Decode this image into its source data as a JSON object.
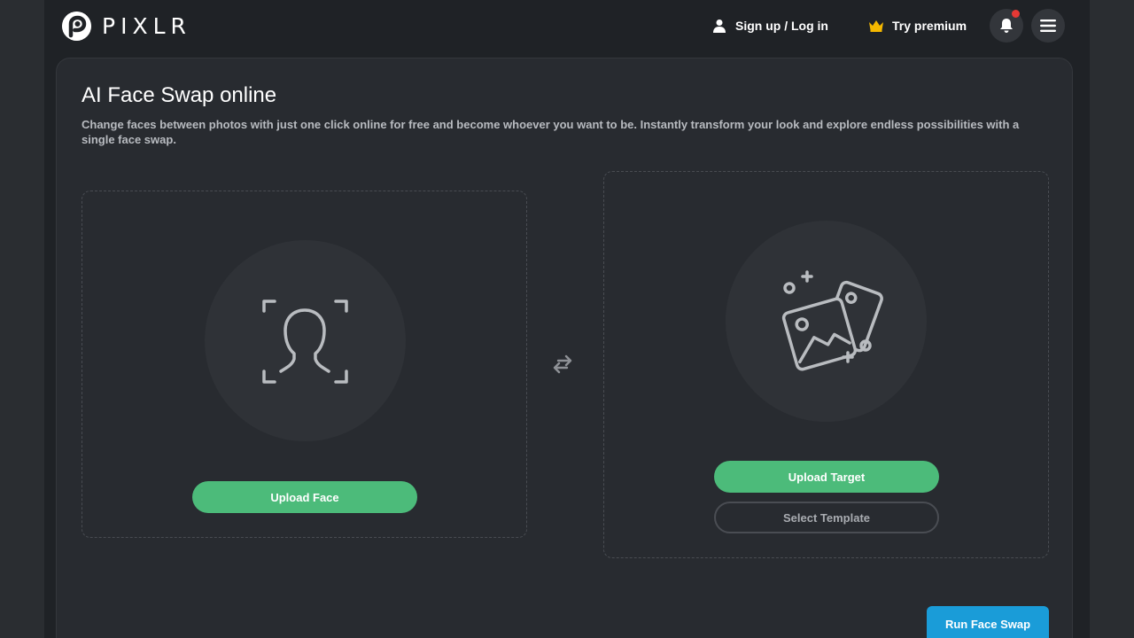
{
  "brand": {
    "name": "PIXLR"
  },
  "nav": {
    "signin_label": "Sign up / Log in",
    "premium_label": "Try premium",
    "icons": [
      "user-icon",
      "crown-icon",
      "bell-icon",
      "menu-icon"
    ]
  },
  "page": {
    "title": "AI Face Swap online",
    "description": "Change faces between photos with just one click online for free and become whoever you want to be. Instantly transform your look and explore endless possibilities with a single face swap."
  },
  "face_panel": {
    "upload_label": "Upload Face"
  },
  "target_panel": {
    "upload_label": "Upload Target",
    "template_label": "Select Template"
  },
  "actions": {
    "run_label": "Run Face Swap"
  },
  "colors": {
    "accent_green": "#4cbb7a",
    "accent_blue": "#1a9cd8",
    "premium_gold": "#f5b800",
    "notification_red": "#e53935"
  }
}
